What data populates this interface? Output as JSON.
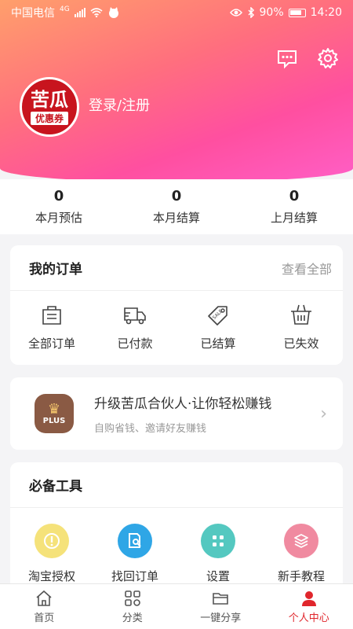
{
  "status_bar": {
    "carrier": "中国电信",
    "network": "4G",
    "battery": "90%",
    "time": "14:20"
  },
  "header": {
    "login_label": "登录/注册",
    "logo_top": "苦瓜",
    "logo_bottom": "优惠券"
  },
  "stats": [
    {
      "value": "0",
      "label": "本月预估"
    },
    {
      "value": "0",
      "label": "本月结算"
    },
    {
      "value": "0",
      "label": "上月结算"
    }
  ],
  "orders": {
    "title": "我的订单",
    "view_all": "查看全部",
    "items": [
      {
        "label": "全部订单",
        "icon": "bag-icon"
      },
      {
        "label": "已付款",
        "icon": "truck-icon"
      },
      {
        "label": "已结算",
        "icon": "tag-icon"
      },
      {
        "label": "已失效",
        "icon": "basket-icon"
      }
    ]
  },
  "plus": {
    "badge": "PLUS",
    "title": "升级苦瓜合伙人·让你轻松赚钱",
    "subtitle": "自购省钱、邀请好友赚钱"
  },
  "tools": {
    "title": "必备工具",
    "items": [
      {
        "label": "淘宝授权",
        "color": "#f5e27a"
      },
      {
        "label": "找回订单",
        "color": "#2fa6e6"
      },
      {
        "label": "设置",
        "color": "#54c8c0"
      },
      {
        "label": "新手教程",
        "color": "#f08aa0"
      }
    ]
  },
  "tabbar": [
    {
      "label": "首页",
      "icon": "home-icon"
    },
    {
      "label": "分类",
      "icon": "category-icon"
    },
    {
      "label": "一键分享",
      "icon": "folder-icon"
    },
    {
      "label": "个人中心",
      "icon": "person-icon",
      "active": true
    }
  ],
  "colors": {
    "accent": "#e0262c",
    "gradient_start": "#ff9f6b",
    "gradient_end": "#ff5fc6"
  }
}
